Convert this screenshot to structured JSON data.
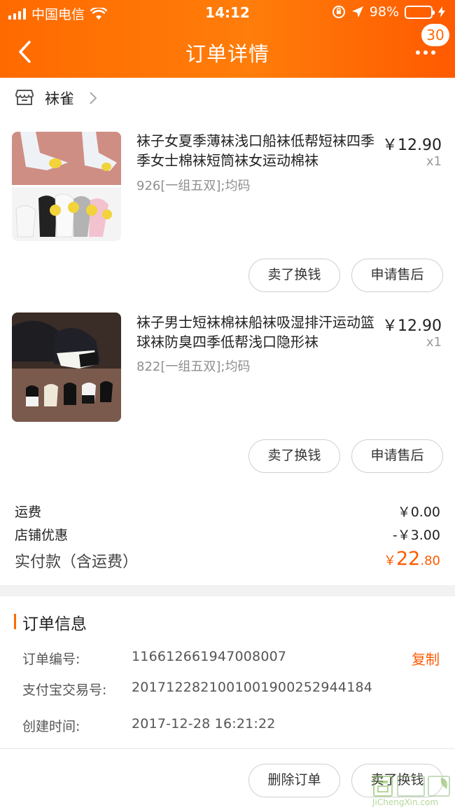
{
  "status_bar": {
    "carrier": "中国电信",
    "time": "14:12",
    "battery": "98%"
  },
  "nav": {
    "title": "订单详情",
    "badge": "30"
  },
  "shop": {
    "name": "袜雀"
  },
  "products": [
    {
      "title": "袜子女夏季薄袜浅口船袜低帮短袜四季季女士棉袜短筒袜女运动棉袜",
      "spec": "926[一组五双];均码",
      "price": "￥12.90",
      "qty": "x1",
      "btn_sell": "卖了换钱",
      "btn_after_sale": "申请售后"
    },
    {
      "title": "袜子男士短袜棉袜船袜吸湿排汗运动篮球袜防臭四季低帮浅口隐形袜",
      "spec": "822[一组五双];均码",
      "price": "￥12.90",
      "qty": "x1",
      "btn_sell": "卖了换钱",
      "btn_after_sale": "申请售后"
    }
  ],
  "summary": {
    "shipping_label": "运费",
    "shipping_value": "￥0.00",
    "discount_label": "店铺优惠",
    "discount_value": "-￥3.00",
    "total_label": "实付款（含运费）",
    "total_currency": "￥",
    "total_int": "22",
    "total_dec": ".80"
  },
  "order_info": {
    "title": "订单信息",
    "order_no_label": "订单编号:",
    "order_no": "116612661947008007",
    "copy_label": "复制",
    "alipay_label": "支付宝交易号:",
    "alipay_no": "2017122821001001900252944184",
    "created_label": "创建时间:",
    "created": "2017-12-28 16:21:22"
  },
  "footer": {
    "delete_label": "删除订单",
    "sell_label": "卖了换钱"
  },
  "watermark": {
    "text": "JiChengXin.com"
  },
  "colors": {
    "accent": "#ff6a00",
    "price": "#ff5a00"
  }
}
